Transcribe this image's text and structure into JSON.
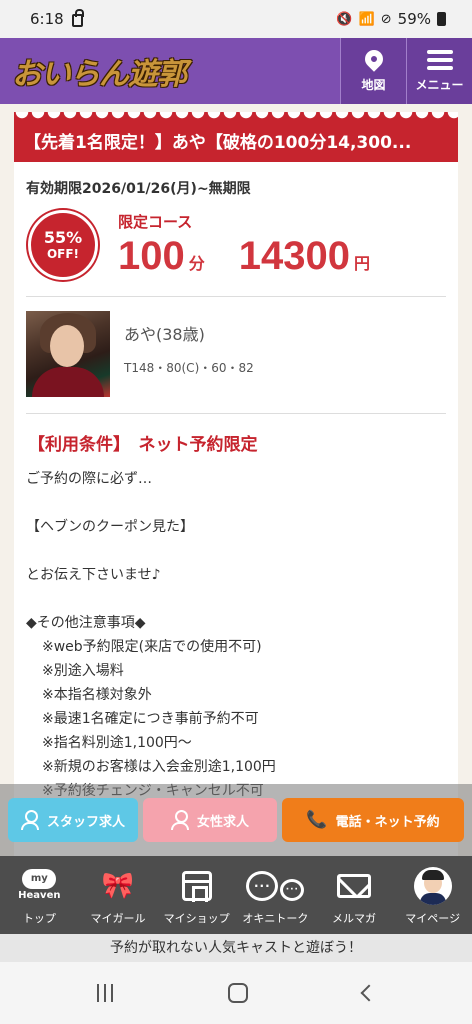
{
  "status": {
    "time": "6:18",
    "battery": "59%"
  },
  "header": {
    "logo": "おいらん遊郭",
    "map_label": "地図",
    "menu_label": "メニュー"
  },
  "coupon": {
    "title": "【先着1名限定！】あや【破格の100分14,300...",
    "valid": "有効期限2026/01/26(月)~無期限",
    "badge_pct": "55%",
    "badge_off": "OFF!",
    "course_label": "限定コース",
    "minutes": "100",
    "minutes_unit": "分",
    "price": "14300",
    "price_unit": "円"
  },
  "cast": {
    "name": "あや(38歳)",
    "spec": "T148・80(C)・60・82"
  },
  "conditions": {
    "title": "【利用条件】　ネット予約限定",
    "line1": "ご予約の際に必ず…",
    "line2": "【ヘブンのクーポン見た】",
    "line3": "とお伝え下さいませ♪",
    "line4": "◆その他注意事項◆",
    "notes": [
      "※web予約限定(来店での使用不可)",
      "※別途入場料",
      "※本指名様対象外",
      "※最速1名確定につき事前予約不可",
      "※指名料別途1,100円〜",
      "※新規のお客様は入会金別途1,100円",
      "※予約後チェンジ・キャンセル不可"
    ]
  },
  "recruit": {
    "staff": "スタッフ求人",
    "female": "女性求人",
    "phone": "電話・ネット予約"
  },
  "bottom_nav": {
    "heaven_top": "my",
    "heaven_bottom": "Heaven",
    "items": [
      "トップ",
      "マイガール",
      "マイショップ",
      "オキニトーク",
      "メルマガ",
      "マイページ"
    ]
  },
  "banner": "予約が取れない人気キャストと遊ぼう！"
}
